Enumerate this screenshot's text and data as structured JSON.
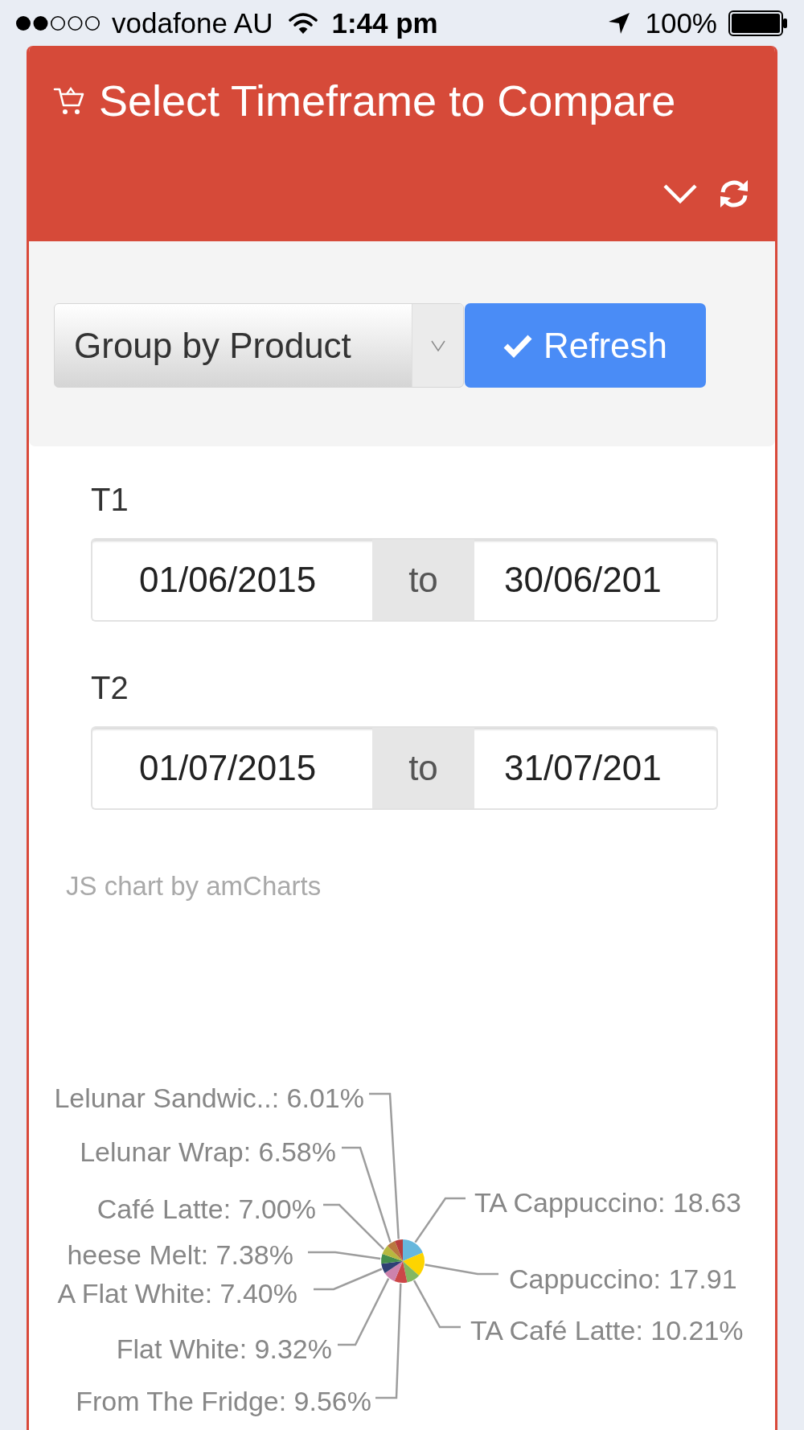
{
  "status_bar": {
    "carrier": "vodafone AU",
    "time": "1:44 pm",
    "battery": "100%"
  },
  "card": {
    "title": "Select Timeframe to Compare",
    "group_select": {
      "value": "Group by Product"
    },
    "refresh_button": "Refresh",
    "timeframes": [
      {
        "label": "T1",
        "from": "01/06/2015",
        "separator": "to",
        "to": "30/06/201"
      },
      {
        "label": "T2",
        "from": "01/07/2015",
        "separator": "to",
        "to": "31/07/201"
      }
    ],
    "chart_credit": "JS chart by amCharts",
    "chart_data": {
      "type": "pie",
      "categories": [
        "TA Cappuccino: 18.63",
        "Cappuccino: 17.91",
        "TA Café Latte: 10.21%",
        "From The Fridge: 9.56%",
        "Flat White: 9.32%",
        "A Flat White: 7.40%",
        "heese Melt: 7.38%",
        "Café Latte: 7.00%",
        "Lelunar Wrap: 6.58%",
        "Lelunar Sandwic..: 6.01%"
      ],
      "values": [
        18.63,
        17.91,
        10.21,
        9.56,
        9.32,
        7.4,
        7.38,
        7.0,
        6.58,
        6.01
      ],
      "colors": [
        "#67b7dc",
        "#fdd400",
        "#84b761",
        "#cc4748",
        "#cd82ad",
        "#2f4074",
        "#448e4d",
        "#b7b83f",
        "#b9783f",
        "#b93e3d"
      ]
    }
  }
}
